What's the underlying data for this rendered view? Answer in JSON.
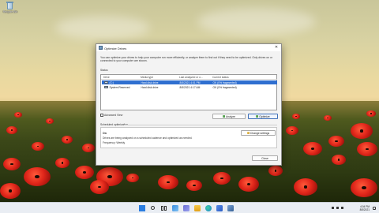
{
  "desktop": {
    "recycle_bin_label": "Recycle Bin"
  },
  "window": {
    "title": "Optimize Drives",
    "close_glyph": "✕",
    "description": "You can optimize your drives to help your computer run more efficiently, or analyze them to find out if they need to be optimized. Only drives on or connected to your computer are shown.",
    "status_label": "Status",
    "columns": [
      "Drive",
      "Media type",
      "Last analyzed or o...",
      "Current status"
    ],
    "drives": [
      {
        "drive": "(C:)",
        "media": "Hard disk drive",
        "last": "8/5/2021 4:01 PM",
        "status": "OK (0% fragmented)",
        "selected": true
      },
      {
        "drive": "System Reserved",
        "media": "Hard disk drive",
        "last": "8/5/2021 4:17 AM",
        "status": "OK (0% fragmented)",
        "selected": false
      }
    ],
    "advanced_view_label": "Advanced View",
    "analyze_label": "Analyze",
    "optimize_label": "Optimize",
    "scheduled_header": "Scheduled optimization",
    "scheduled_state": "On",
    "scheduled_desc": "Drives are being analyzed on a scheduled cadence and optimized as needed.",
    "frequency": "Frequency: Weekly",
    "change_settings_label": "Change settings",
    "close_label": "Close"
  },
  "taskbar": {
    "time": "4:04 PM",
    "date": "8/5/2021"
  },
  "colors": {
    "selection": "#2f6fd0",
    "accent": "#2a7de1"
  }
}
